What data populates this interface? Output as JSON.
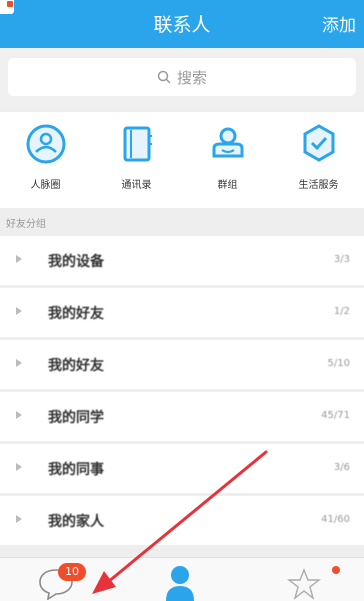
{
  "header": {
    "title": "联系人",
    "add_label": "添加"
  },
  "search": {
    "placeholder": "搜索"
  },
  "quick_actions": [
    {
      "label": "人脉圈",
      "icon": "people-circle-icon"
    },
    {
      "label": "通讯录",
      "icon": "address-book-icon"
    },
    {
      "label": "群组",
      "icon": "group-icon"
    },
    {
      "label": "生活服务",
      "icon": "life-service-icon"
    }
  ],
  "section_label": "好友分组",
  "groups": [
    {
      "name": "我的设备",
      "count": "3/3"
    },
    {
      "name": "我的好友",
      "count": "1/2"
    },
    {
      "name": "我的好友",
      "count": "5/10"
    },
    {
      "name": "我的同学",
      "count": "45/71"
    },
    {
      "name": "我的同事",
      "count": "3/6"
    },
    {
      "name": "我的家人",
      "count": "41/60"
    }
  ],
  "tabbar": {
    "badge_count": "10"
  },
  "colors": {
    "accent": "#2aa5ec",
    "badge": "#f04d2c",
    "annotation_arrow": "#e8323a"
  }
}
